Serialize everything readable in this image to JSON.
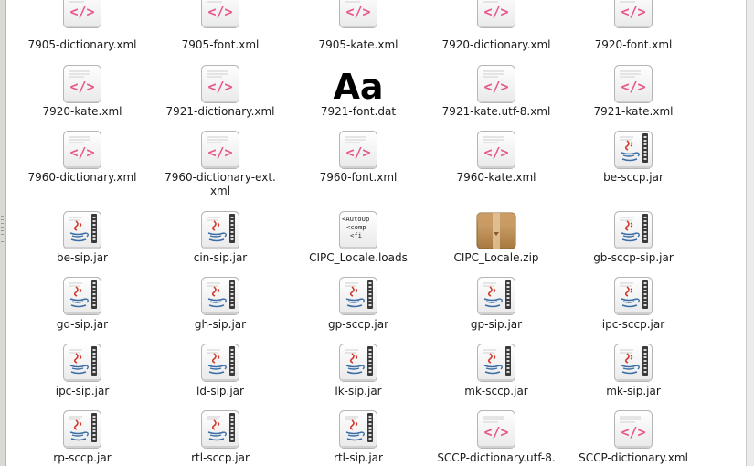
{
  "file_manager": {
    "files": [
      {
        "name": "7905-dictionary.xml",
        "type": "xml"
      },
      {
        "name": "7905-font.xml",
        "type": "xml"
      },
      {
        "name": "7905-kate.xml",
        "type": "xml"
      },
      {
        "name": "7920-dictionary.xml",
        "type": "xml"
      },
      {
        "name": "7920-font.xml",
        "type": "xml"
      },
      {
        "name": "7920-kate.xml",
        "type": "xml"
      },
      {
        "name": "7921-dictionary.xml",
        "type": "xml"
      },
      {
        "name": "7921-font.dat",
        "type": "font"
      },
      {
        "name": "7921-kate.utf-8.xml",
        "type": "xml"
      },
      {
        "name": "7921-kate.xml",
        "type": "xml"
      },
      {
        "name": "7960-dictionary.xml",
        "type": "xml"
      },
      {
        "name": "7960-dictionary-ext.xml",
        "type": "xml"
      },
      {
        "name": "7960-font.xml",
        "type": "xml"
      },
      {
        "name": "7960-kate.xml",
        "type": "xml"
      },
      {
        "name": "be-sccp.jar",
        "type": "jar"
      },
      {
        "name": "be-sip.jar",
        "type": "jar"
      },
      {
        "name": "cin-sip.jar",
        "type": "jar"
      },
      {
        "name": "CIPC_Locale.loads",
        "type": "loads"
      },
      {
        "name": "CIPC_Locale.zip",
        "type": "zip"
      },
      {
        "name": "gb-sccp-sip.jar",
        "type": "jar"
      },
      {
        "name": "gd-sip.jar",
        "type": "jar"
      },
      {
        "name": "gh-sip.jar",
        "type": "jar"
      },
      {
        "name": "gp-sccp.jar",
        "type": "jar"
      },
      {
        "name": "gp-sip.jar",
        "type": "jar"
      },
      {
        "name": "ipc-sccp.jar",
        "type": "jar"
      },
      {
        "name": "ipc-sip.jar",
        "type": "jar"
      },
      {
        "name": "ld-sip.jar",
        "type": "jar"
      },
      {
        "name": "lk-sip.jar",
        "type": "jar"
      },
      {
        "name": "mk-sccp.jar",
        "type": "jar"
      },
      {
        "name": "mk-sip.jar",
        "type": "jar"
      },
      {
        "name": "rp-sccp.jar",
        "type": "jar"
      },
      {
        "name": "rtl-sccp.jar",
        "type": "jar"
      },
      {
        "name": "rtl-sip.jar",
        "type": "jar"
      },
      {
        "name": "SCCP-dictionary.utf-8.",
        "type": "xml"
      },
      {
        "name": "SCCP-dictionary.xml",
        "type": "xml"
      }
    ],
    "icon_text": {
      "font_preview": "Aa",
      "loads_preview": [
        "<AutoUp",
        "<comp",
        "<fi"
      ]
    },
    "colors": {
      "xml_tag": "#e8558c",
      "java_red": "#d33a2c",
      "java_blue": "#3b6ea5",
      "zip_box": "#c99a62"
    }
  }
}
